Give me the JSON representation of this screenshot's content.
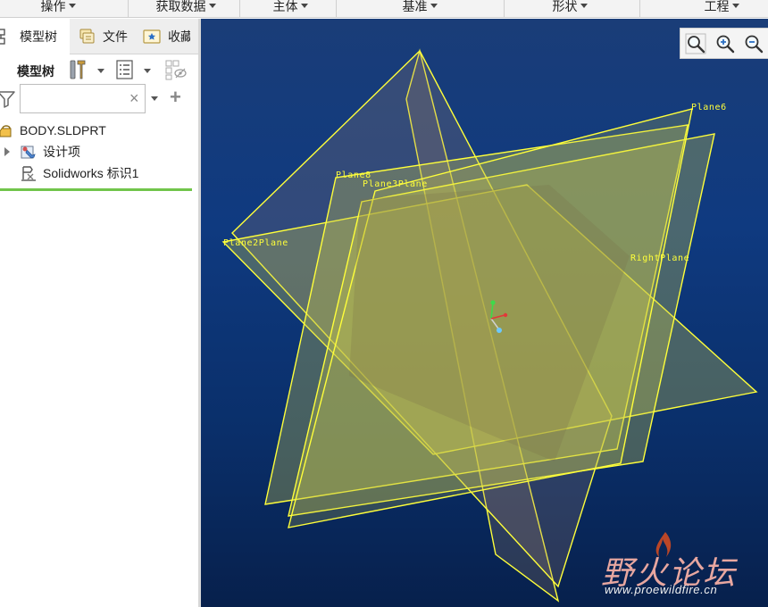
{
  "menubar": {
    "items": [
      "操作",
      "获取数据",
      "主体",
      "基准",
      "形状",
      "工程"
    ]
  },
  "left_panel": {
    "tabs": [
      "模型树",
      "文件",
      "收藏"
    ],
    "toolbar": {
      "label": "模型树"
    },
    "filter": {
      "value": "",
      "placeholder": "",
      "clear_glyph": "×",
      "add_glyph": "+"
    },
    "tree": {
      "root": "BODY.SLDPRT",
      "children": [
        "设计项",
        "Solidworks 标识1"
      ]
    }
  },
  "viewport": {
    "planes": [
      "Plane6",
      "Plane8",
      "Plane3Plane",
      "Plane2Plane",
      "RightPlane"
    ],
    "plane_color": "#ffff3a",
    "watermark": {
      "title": "野火论坛",
      "url": "www.proewildfire.cn"
    }
  },
  "icons": [
    "model-tree-icon",
    "files-icon",
    "favorites-icon",
    "settings-icon",
    "tree-columns-icon",
    "show-hide-icon",
    "filter-icon",
    "part-icon",
    "design-items-icon",
    "solidworks-id-icon",
    "zoom-fit-icon",
    "zoom-in-icon",
    "zoom-out-icon"
  ]
}
